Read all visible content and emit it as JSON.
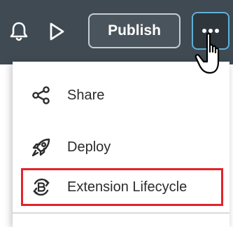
{
  "toolbar": {
    "publish_label": "Publish",
    "icons": [
      "bell-icon",
      "play-icon",
      "more-icon"
    ]
  },
  "menu": {
    "items": [
      {
        "label": "Share",
        "icon": "share-icon"
      },
      {
        "label": "Deploy",
        "icon": "rocket-icon"
      },
      {
        "label": "Extension Lifecycle",
        "icon": "lifecycle-icon"
      }
    ]
  },
  "colors": {
    "toolbar_bg": "#3f4a52",
    "highlight_border": "#e3232a",
    "focus_border": "#5fb0d7"
  }
}
